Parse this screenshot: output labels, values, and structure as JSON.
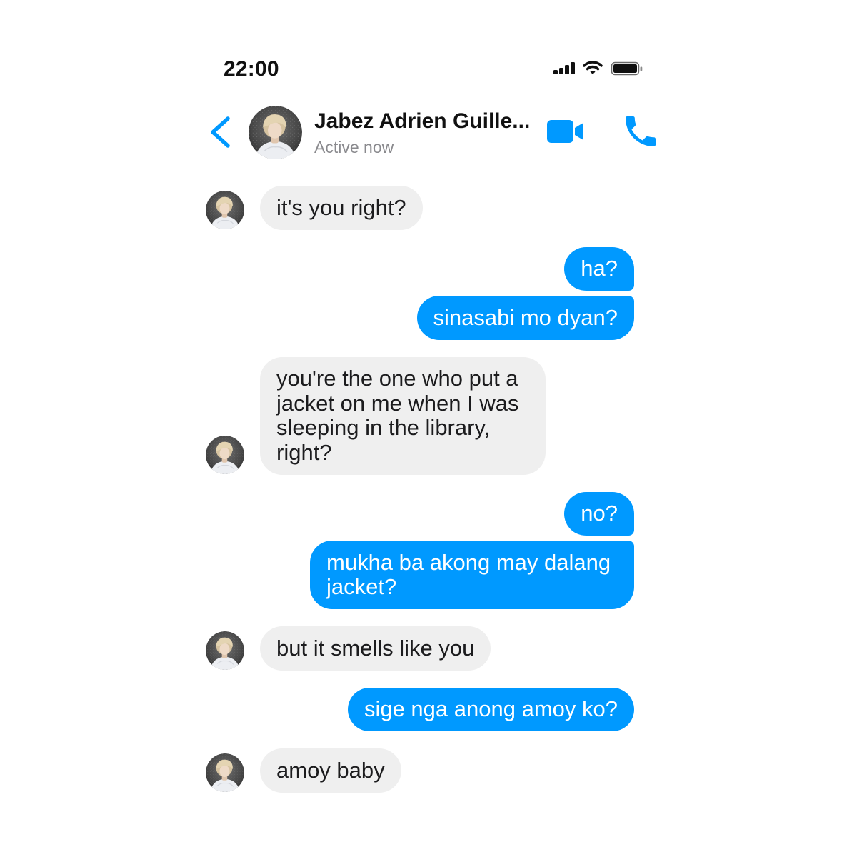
{
  "status_bar": {
    "time": "22:00",
    "signal_icon": "cellular-signal-icon",
    "wifi_icon": "wifi-icon",
    "battery_icon": "battery-icon"
  },
  "header": {
    "back_icon": "chevron-left-icon",
    "contact_name": "Jabez Adrien Guille...",
    "status": "Active now",
    "video_call_icon": "video-camera-icon",
    "voice_call_icon": "phone-icon"
  },
  "colors": {
    "accent": "#0099FF",
    "received_bubble": "#EFEFEF",
    "received_text": "#1C1C1E",
    "sent_text": "#FFFFFF",
    "secondary_text": "#8A8A8E",
    "background": "#FFFFFF"
  },
  "messages": [
    {
      "incoming": true,
      "text": "it's you right?"
    },
    {
      "incoming": false,
      "text": "ha?"
    },
    {
      "incoming": false,
      "text": "sinasabi mo dyan?"
    },
    {
      "incoming": true,
      "text": "you're the one who put a jacket on me when I was sleeping in the library, right?"
    },
    {
      "incoming": false,
      "text": "no?"
    },
    {
      "incoming": false,
      "text": "mukha ba akong may dalang jacket?"
    },
    {
      "incoming": true,
      "text": "but it smells like you"
    },
    {
      "incoming": false,
      "text": "sige nga anong amoy ko?"
    },
    {
      "incoming": true,
      "text": "amoy baby"
    }
  ]
}
